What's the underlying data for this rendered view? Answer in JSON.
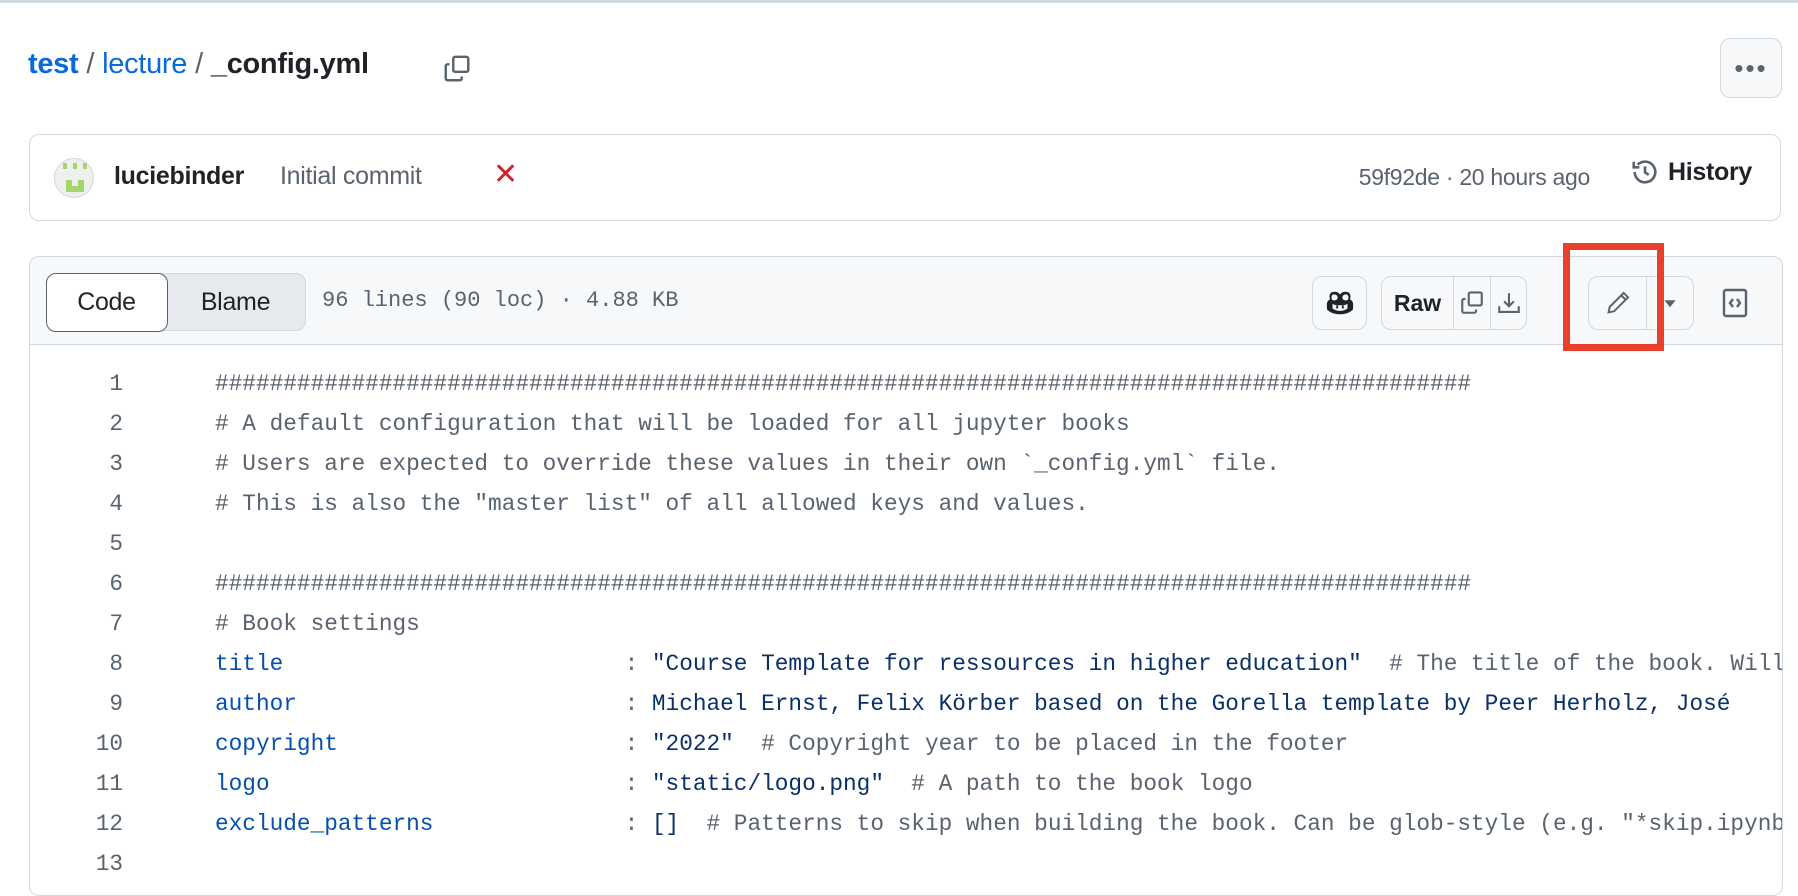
{
  "breadcrumb": {
    "repo": "test",
    "folder": "lecture",
    "file": "_config.yml",
    "separator": "/"
  },
  "more_label": "•••",
  "commit": {
    "author": "luciebinder",
    "message": "Initial commit",
    "status": "✕",
    "hash": "59f92de",
    "time": "20 hours ago",
    "meta": "59f92de · 20 hours ago",
    "history_label": "History"
  },
  "file_header": {
    "tabs": [
      {
        "label": "Code",
        "active": true
      },
      {
        "label": "Blame",
        "active": false
      }
    ],
    "info": "96 lines (90 loc) · 4.88 KB",
    "raw_label": "Raw"
  },
  "highlight_color": "#e8402a",
  "code_lines": [
    {
      "n": "1",
      "parts": [
        {
          "t": "############################################################################################",
          "c": "c"
        }
      ]
    },
    {
      "n": "2",
      "parts": [
        {
          "t": "# A default configuration that will be loaded for all jupyter books",
          "c": "c"
        }
      ]
    },
    {
      "n": "3",
      "parts": [
        {
          "t": "# Users are expected to override these values in their own `_config.yml` file.",
          "c": "c"
        }
      ]
    },
    {
      "n": "4",
      "parts": [
        {
          "t": "# This is also the \"master list\" of all allowed keys and values.",
          "c": "c"
        }
      ]
    },
    {
      "n": "5",
      "parts": []
    },
    {
      "n": "6",
      "parts": [
        {
          "t": "############################################################################################",
          "c": "c"
        }
      ]
    },
    {
      "n": "7",
      "parts": [
        {
          "t": "# Book settings",
          "c": "c"
        }
      ]
    },
    {
      "n": "8",
      "parts": [
        {
          "t": "title                         ",
          "c": "k"
        },
        {
          "t": ": ",
          "c": "c"
        },
        {
          "t": "\"Course Template for ressources in higher education\"",
          "c": "s"
        },
        {
          "t": "  # The title of the book. Will be placed in the left navbar.",
          "c": "c"
        }
      ]
    },
    {
      "n": "9",
      "parts": [
        {
          "t": "author                        ",
          "c": "k"
        },
        {
          "t": ": ",
          "c": "c"
        },
        {
          "t": "Michael Ernst, Felix Körber based on the Gorella template by Peer Herholz, José",
          "c": "s"
        }
      ]
    },
    {
      "n": "10",
      "parts": [
        {
          "t": "copyright                     ",
          "c": "k"
        },
        {
          "t": ": ",
          "c": "c"
        },
        {
          "t": "\"2022\"",
          "c": "s"
        },
        {
          "t": "  # Copyright year to be placed in the footer",
          "c": "c"
        }
      ]
    },
    {
      "n": "11",
      "parts": [
        {
          "t": "logo                          ",
          "c": "k"
        },
        {
          "t": ": ",
          "c": "c"
        },
        {
          "t": "\"static/logo.png\"",
          "c": "s"
        },
        {
          "t": "  # A path to the book logo",
          "c": "c"
        }
      ]
    },
    {
      "n": "12",
      "parts": [
        {
          "t": "exclude_patterns              ",
          "c": "k"
        },
        {
          "t": ": ",
          "c": "c"
        },
        {
          "t": "[]",
          "c": "s"
        },
        {
          "t": "  # Patterns to skip when building the book. Can be glob-style (e.g. \"*skip.ipynb\")",
          "c": "c"
        }
      ]
    },
    {
      "n": "13",
      "parts": []
    }
  ]
}
